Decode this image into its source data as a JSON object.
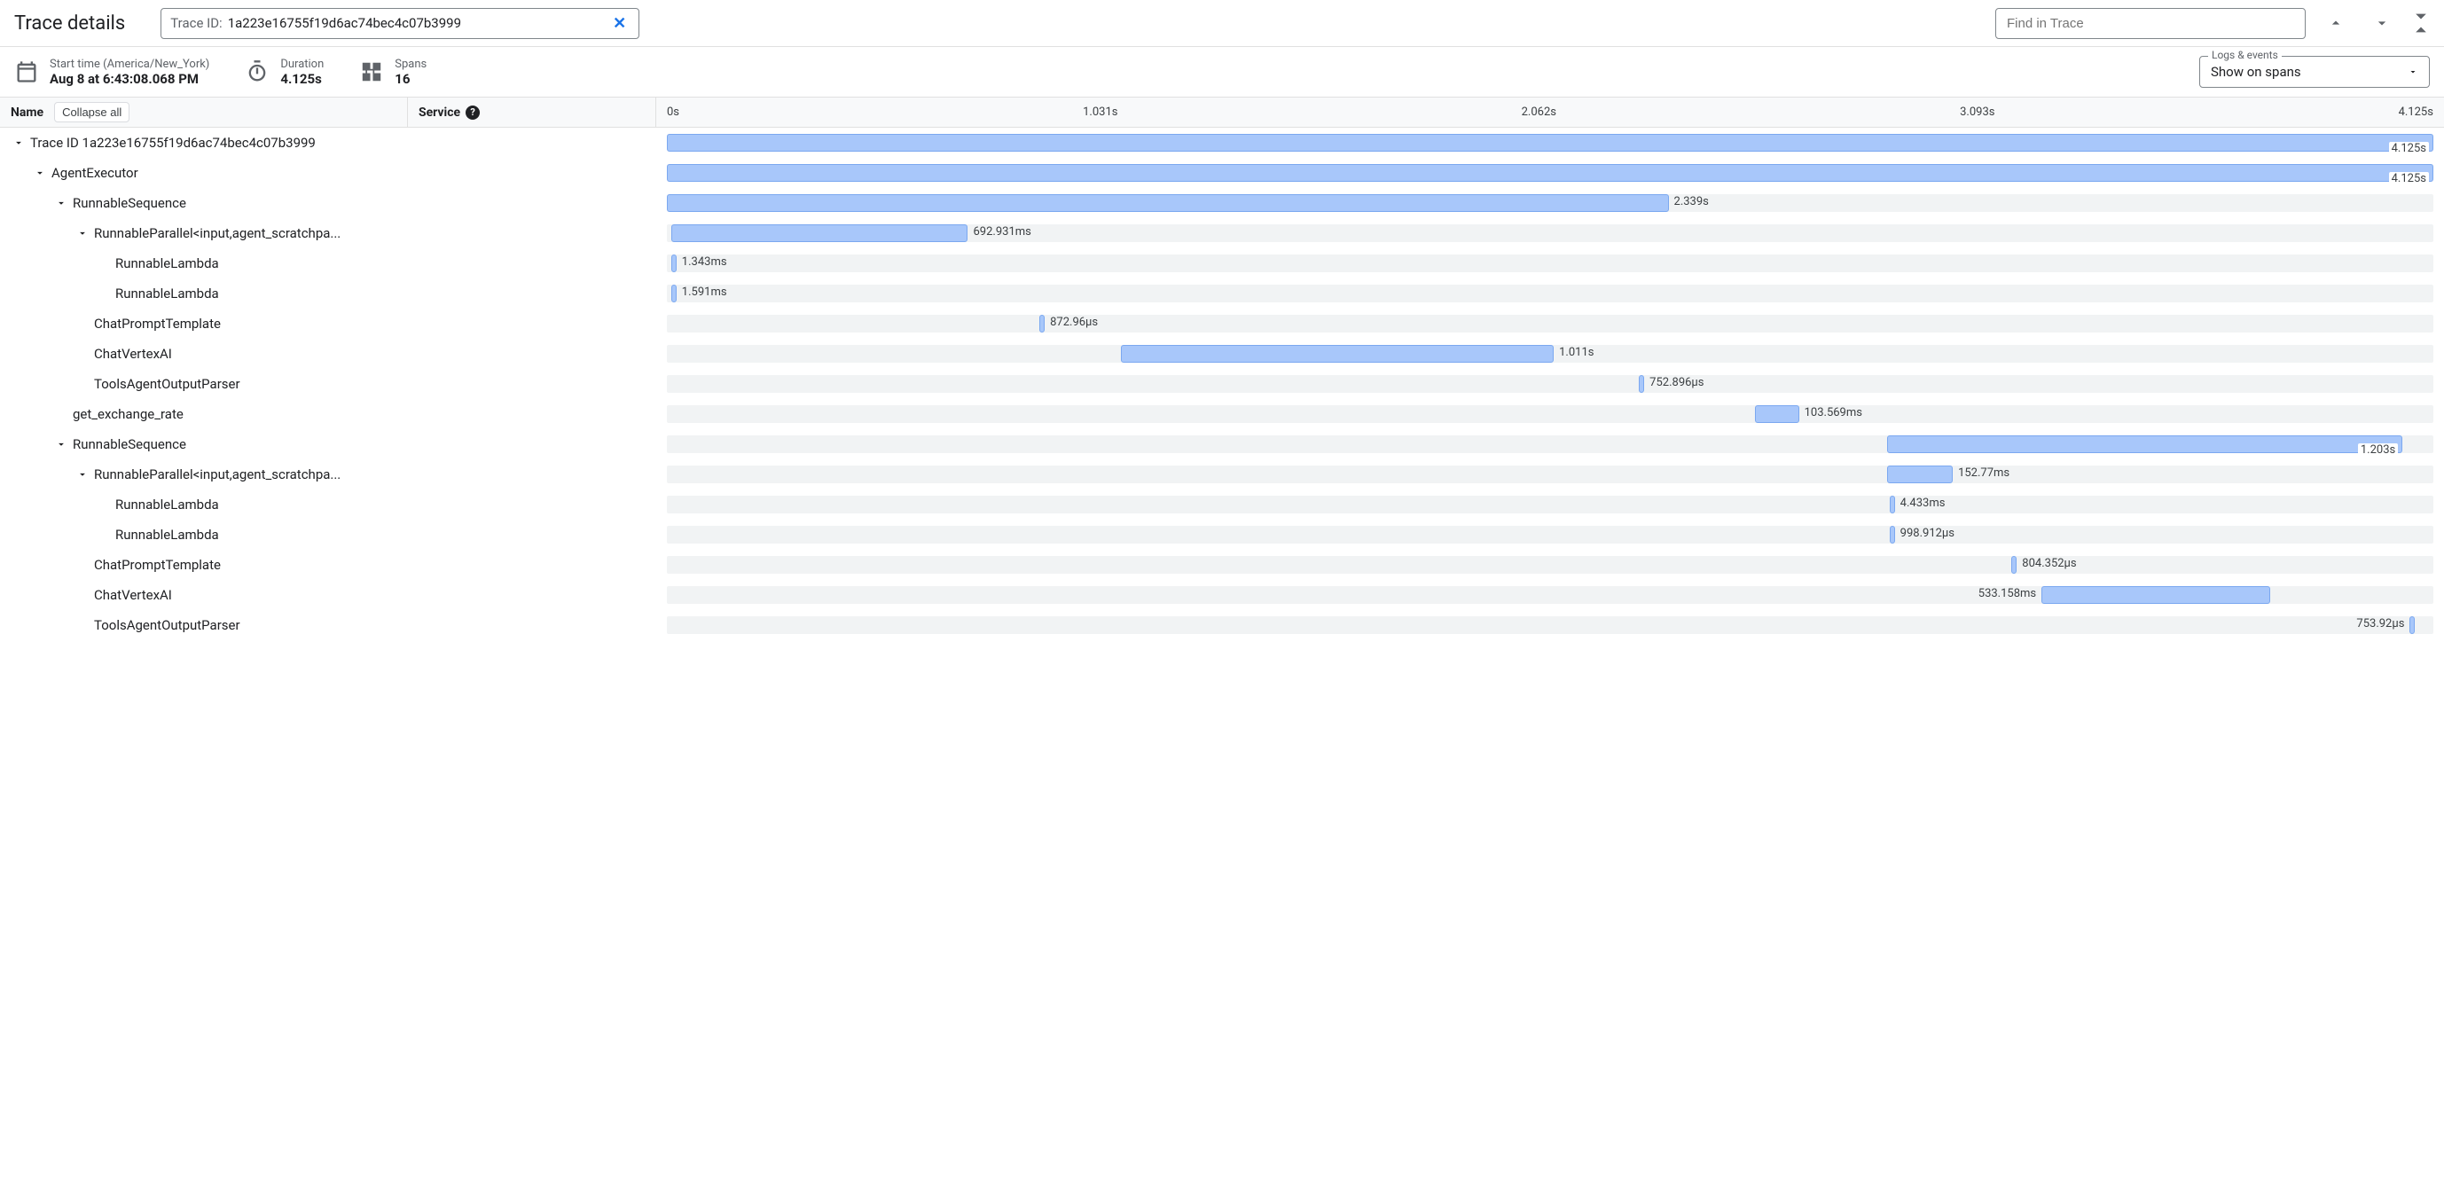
{
  "header": {
    "title": "Trace details",
    "traceIdLabel": "Trace ID:",
    "traceIdValue": "1a223e16755f19d6ac74bec4c07b3999",
    "findPlaceholder": "Find in Trace"
  },
  "subheader": {
    "startTimeLabel": "Start time (America/New_York)",
    "startTimeValue": "Aug 8 at 6:43:08.068 PM",
    "durationLabel": "Duration",
    "durationValue": "4.125s",
    "spansLabel": "Spans",
    "spansValue": "16",
    "logsEventsLabel": "Logs & events",
    "logsEventsValue": "Show on spans"
  },
  "columns": {
    "name": "Name",
    "collapseAll": "Collapse all",
    "service": "Service",
    "timeTicks": [
      "0s",
      "1.031s",
      "2.062s",
      "3.093s",
      "4.125s"
    ]
  },
  "totalDurationMs": 4125,
  "spans": [
    {
      "name": "Trace ID 1a223e16755f19d6ac74bec4c07b3999",
      "depth": 0,
      "expandable": true,
      "expanded": true,
      "startMs": 0,
      "widthMs": 4125,
      "duration": "4.125s",
      "labelPos": "inside"
    },
    {
      "name": "AgentExecutor",
      "depth": 1,
      "expandable": true,
      "expanded": true,
      "startMs": 0,
      "widthMs": 4125,
      "duration": "4.125s",
      "labelPos": "inside"
    },
    {
      "name": "RunnableSequence",
      "depth": 2,
      "expandable": true,
      "expanded": true,
      "startMs": 0,
      "widthMs": 2339,
      "duration": "2.339s",
      "labelPos": "right"
    },
    {
      "name": "RunnableParallel<input,agent_scratchpa...",
      "depth": 3,
      "expandable": true,
      "expanded": true,
      "startMs": 10,
      "widthMs": 693,
      "duration": "692.931ms",
      "labelPos": "right"
    },
    {
      "name": "RunnableLambda",
      "depth": 4,
      "expandable": false,
      "startMs": 10,
      "widthMs": 1.343,
      "duration": "1.343ms",
      "labelPos": "right",
      "tiny": true
    },
    {
      "name": "RunnableLambda",
      "depth": 4,
      "expandable": false,
      "startMs": 10,
      "widthMs": 1.591,
      "duration": "1.591ms",
      "labelPos": "right",
      "tiny": true,
      "lastChild": true
    },
    {
      "name": "ChatPromptTemplate",
      "depth": 3,
      "expandable": false,
      "startMs": 870,
      "widthMs": 0.873,
      "duration": "872.96µs",
      "labelPos": "right",
      "tiny": true
    },
    {
      "name": "ChatVertexAI",
      "depth": 3,
      "expandable": false,
      "startMs": 1060,
      "widthMs": 1011,
      "duration": "1.011s",
      "labelPos": "right"
    },
    {
      "name": "ToolsAgentOutputParser",
      "depth": 3,
      "expandable": false,
      "startMs": 2270,
      "widthMs": 0.753,
      "duration": "752.896µs",
      "labelPos": "right",
      "tiny": true,
      "lastChild": true
    },
    {
      "name": "get_exchange_rate",
      "depth": 2,
      "expandable": false,
      "startMs": 2540,
      "widthMs": 103.569,
      "duration": "103.569ms",
      "labelPos": "right"
    },
    {
      "name": "RunnableSequence",
      "depth": 2,
      "expandable": true,
      "expanded": true,
      "startMs": 2850,
      "widthMs": 1203,
      "duration": "1.203s",
      "labelPos": "inside",
      "lastChild": true
    },
    {
      "name": "RunnableParallel<input,agent_scratchpa...",
      "depth": 3,
      "expandable": true,
      "expanded": true,
      "startMs": 2850,
      "widthMs": 152.77,
      "duration": "152.77ms",
      "labelPos": "right"
    },
    {
      "name": "RunnableLambda",
      "depth": 4,
      "expandable": false,
      "startMs": 2855,
      "widthMs": 4.433,
      "duration": "4.433ms",
      "labelPos": "right",
      "tiny": true
    },
    {
      "name": "RunnableLambda",
      "depth": 4,
      "expandable": false,
      "startMs": 2855,
      "widthMs": 0.999,
      "duration": "998.912µs",
      "labelPos": "right",
      "tiny": true,
      "lastChild": true
    },
    {
      "name": "ChatPromptTemplate",
      "depth": 3,
      "expandable": false,
      "startMs": 3140,
      "widthMs": 0.804,
      "duration": "804.352µs",
      "labelPos": "right",
      "tiny": true
    },
    {
      "name": "ChatVertexAI",
      "depth": 3,
      "expandable": false,
      "startMs": 3210,
      "widthMs": 533.158,
      "duration": "533.158ms",
      "labelPos": "left"
    },
    {
      "name": "ToolsAgentOutputParser",
      "depth": 3,
      "expandable": false,
      "startMs": 4070,
      "widthMs": 0.754,
      "duration": "753.92µs",
      "labelPos": "left",
      "tiny": true,
      "lastChild": true
    }
  ]
}
